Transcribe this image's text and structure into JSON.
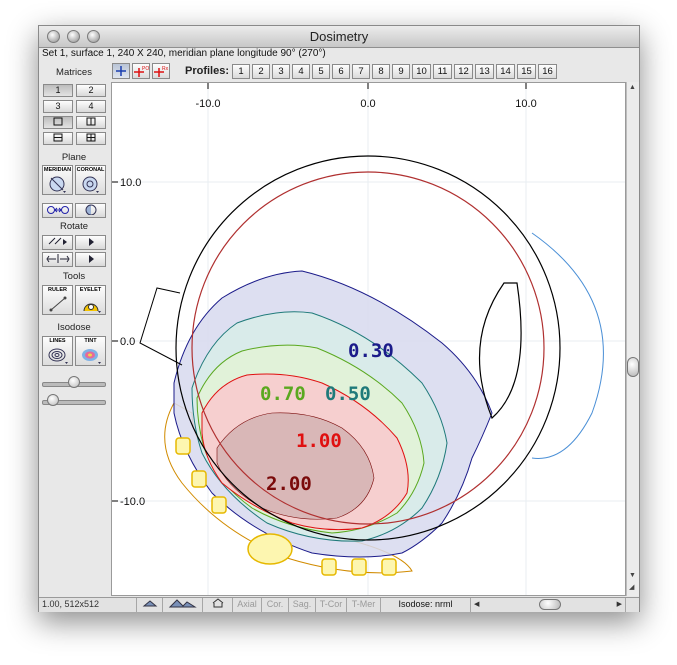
{
  "window": {
    "title": "Dosimetry",
    "subtitle": "Set 1, surface 1, 240 X 240, meridian plane longitude 90° (270°)"
  },
  "sidebar": {
    "matrices_label": "Matrices",
    "matrix_buttons": [
      "1",
      "2",
      "3",
      "4"
    ],
    "plane_label": "Plane",
    "meridian_label": "MERIDIAN",
    "coronal_label": "CORONAL",
    "rotate_label": "Rotate",
    "tools_label": "Tools",
    "ruler_label": "RULER",
    "eyelet_label": "EYELET",
    "isodose_label": "Isodose",
    "lines_label": "LINES",
    "tint_label": "TINT",
    "slider1_level": 0.5,
    "slider2_level": 0.1
  },
  "toolbar": {
    "profiles_label": "Profiles:",
    "profiles": [
      "1",
      "2",
      "3",
      "4",
      "5",
      "6",
      "7",
      "8",
      "9",
      "10",
      "11",
      "12",
      "13",
      "14",
      "15",
      "16"
    ],
    "icon_names": [
      "crosshair-icon",
      "poi-crosshair-icon",
      "rx-crosshair-icon"
    ]
  },
  "plot": {
    "x_ticks": [
      "-10.0",
      "0.0",
      "10.0"
    ],
    "y_ticks": [
      "10.0",
      "0.0",
      "-10.0"
    ],
    "isodose_labels": {
      "l030": "0.30",
      "l050": "0.50",
      "l070": "0.70",
      "l100": "1.00",
      "l200": "2.00"
    },
    "colors": {
      "iso030": "#1b1b8a",
      "iso050": "#1f7a7a",
      "iso070": "#5aa81f",
      "iso100": "#e01010",
      "iso200": "#7a0a0a",
      "lens_curve": "#4a8fd6",
      "eye_inner": "#b03030"
    }
  },
  "statusbar": {
    "zoom": "1.00, 512x512",
    "views": [
      "Axial",
      "Cor.",
      "Sag.",
      "T-Cor",
      "T-Mer"
    ],
    "isodose": "Isodose: nrml"
  }
}
